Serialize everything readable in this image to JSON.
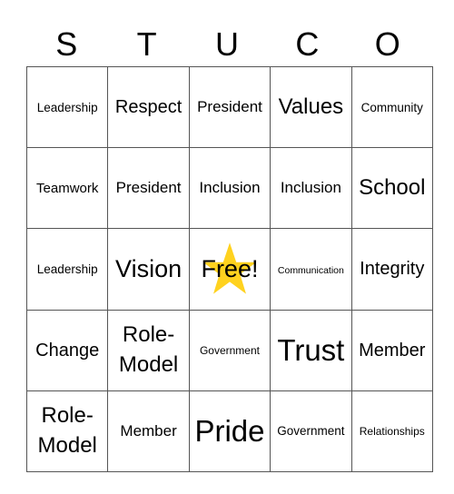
{
  "header": {
    "letters": [
      "S",
      "T",
      "U",
      "C",
      "O"
    ]
  },
  "free_cell": {
    "label": "Free!",
    "icon": "star-icon",
    "star_color": "#FFD21F"
  },
  "rows": [
    [
      "Leadership",
      "Respect",
      "President",
      "Values",
      "Community"
    ],
    [
      "Teamwork",
      "President",
      "Inclusion",
      "Inclusion",
      "School"
    ],
    [
      "Leadership",
      "Vision",
      "Free!",
      "Communication",
      "Integrity"
    ],
    [
      "Change",
      "Role-Model",
      "Government",
      "Trust",
      "Member"
    ],
    [
      "Role-Model",
      "Member",
      "Pride",
      "Government",
      "Relationships"
    ]
  ]
}
